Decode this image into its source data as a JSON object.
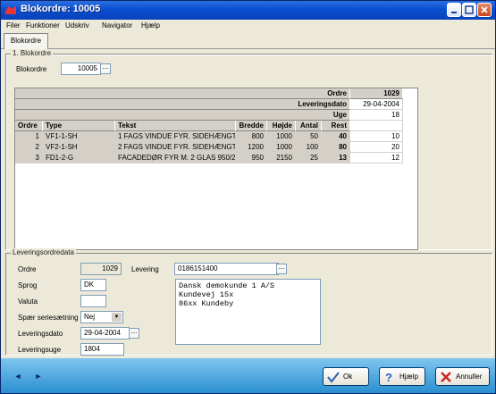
{
  "window": {
    "title": "Blokordre: 10005"
  },
  "menu": [
    "Filer",
    "Funktioner",
    "Udskriv",
    "Navigator",
    "Hjælp"
  ],
  "tab": "Blokordre",
  "section1": {
    "title": "1. Blokordre",
    "blokordre_label": "Blokordre",
    "blokordre_value": "10005"
  },
  "summary": {
    "ordre_label": "Ordre",
    "ordre_value": "1029",
    "leveringsdato_label": "Leveringsdato",
    "leveringsdato_value": "29-04-2004",
    "uge_label": "Uge",
    "uge_value": "18"
  },
  "table": {
    "columns": [
      "Ordre",
      "Type",
      "Tekst",
      "Bredde",
      "Højde",
      "Antal",
      "Rest"
    ],
    "rows": [
      {
        "ordre": "1",
        "type": "VF1-1-SH",
        "tekst": "1 FAGS VINDUE FYR. SIDEHÆNGT",
        "bredde": "800",
        "hojde": "1000",
        "antal": "50",
        "rest": "40",
        "value": "10"
      },
      {
        "ordre": "2",
        "type": "VF2-1-SH",
        "tekst": "2 FAGS VINDUE FYR. SIDEHÆNGT",
        "bredde": "1200",
        "hojde": "1000",
        "antal": "100",
        "rest": "80",
        "value": "20"
      },
      {
        "ordre": "3",
        "type": "FD1-2-G",
        "tekst": "FACADEDØR FYR M. 2 GLAS 950/2",
        "bredde": "950",
        "hojde": "2150",
        "antal": "25",
        "rest": "13",
        "value": "12"
      }
    ]
  },
  "section2": {
    "title": "Leveringsordredata",
    "ordre_label": "Ordre",
    "ordre_value": "1029",
    "levering_label": "Levering",
    "levering_value": "0186151400",
    "sprog_label": "Sprog",
    "sprog_value": "DK",
    "valuta_label": "Valuta",
    "valuta_value": "",
    "spaer_label": "Spær seriesætning",
    "spaer_value": "Nej",
    "leveringsdato_label": "Leveringsdato",
    "leveringsdato_value": "29-04-2004",
    "leveringsuge_label": "Leveringsuge",
    "leveringsuge_value": "1804",
    "address": [
      "Dansk demokunde 1 A/S",
      "Kundevej 15x",
      "86xx Kundeby"
    ]
  },
  "footer": {
    "ok": "Ok",
    "help": "Hjælp",
    "cancel": "Annuller"
  },
  "colors": {
    "titlebar": "#0b4fd0",
    "footer": "#2a8fd0"
  }
}
